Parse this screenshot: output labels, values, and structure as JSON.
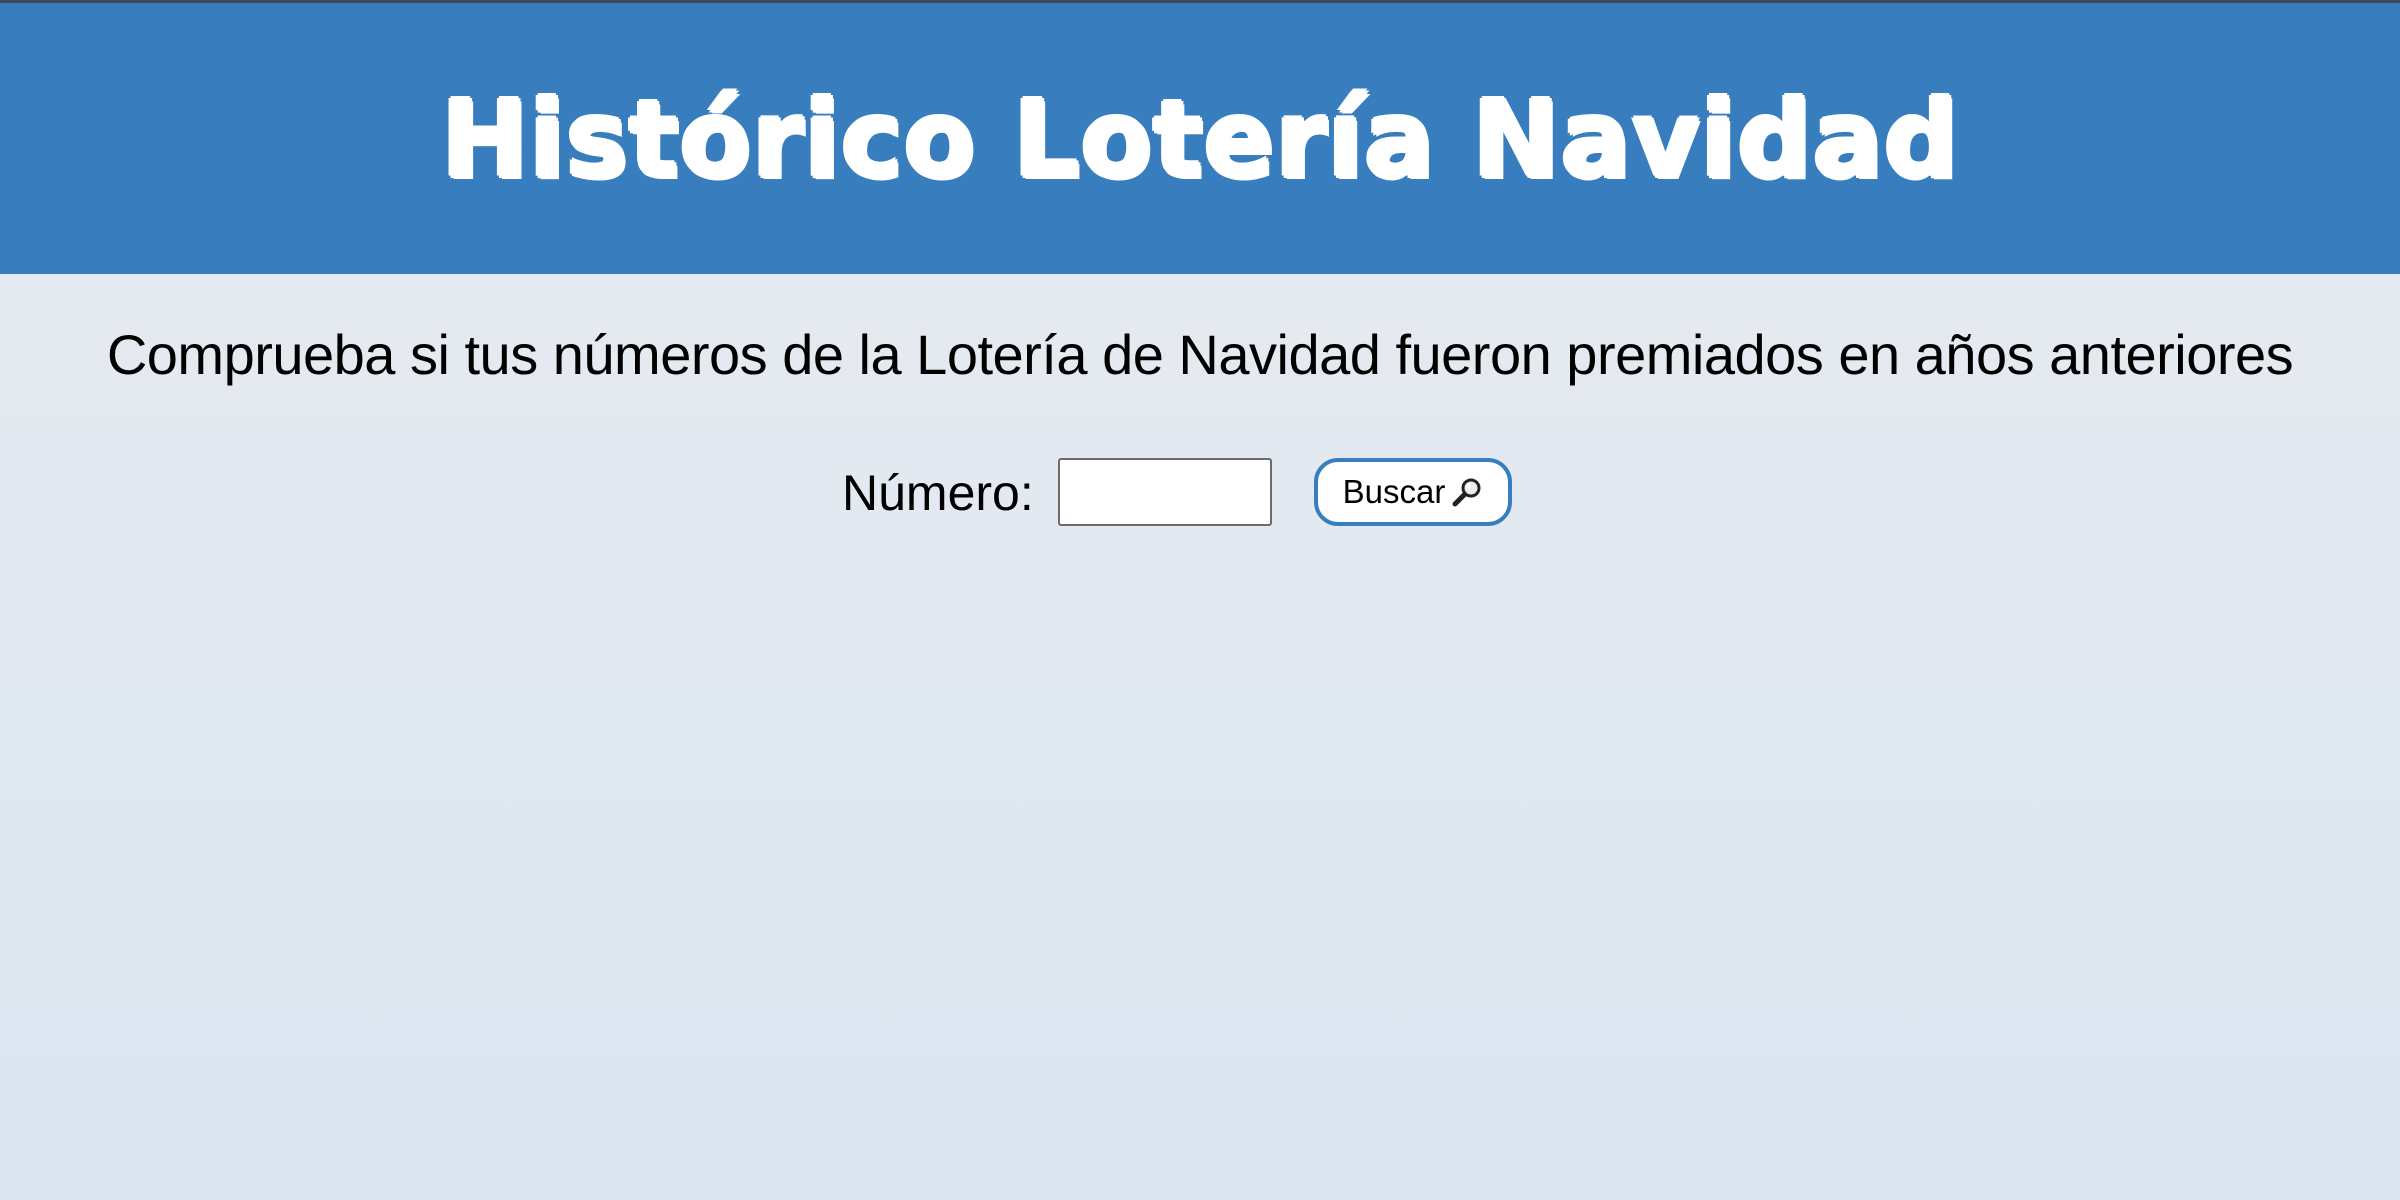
{
  "header": {
    "title": "Histórico Lotería Navidad"
  },
  "main": {
    "subtitle": "Comprueba si tus números de la Lotería de Navidad fueron premiados en años anteriores",
    "search": {
      "label": "Número:",
      "value": "",
      "placeholder": "",
      "button_label": "Buscar",
      "button_icon": "magnifying-glass-icon"
    }
  },
  "colors": {
    "header_background": "#387ebe",
    "header_text": "#ffffff",
    "button_border": "#387ebe",
    "page_background_top": "#e8ebef",
    "page_background_bottom": "#dbe6f1"
  }
}
